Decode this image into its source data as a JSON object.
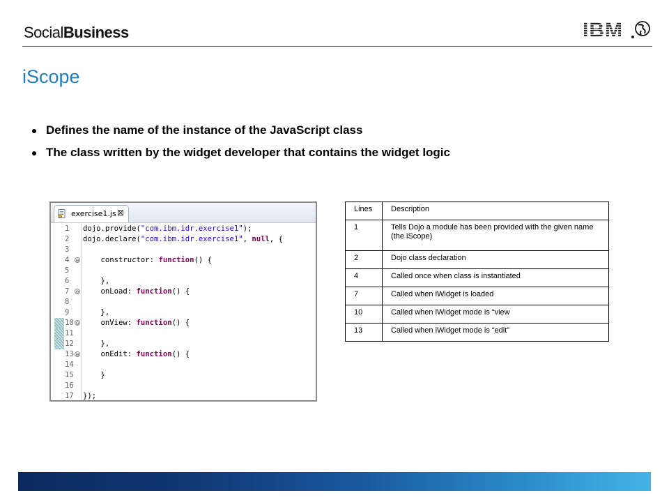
{
  "header": {
    "brand_part1": "Social",
    "brand_part2": "Business",
    "logo_text": "IBM"
  },
  "title": "iScope",
  "bullets": [
    "Defines the name of the instance of the JavaScript class",
    "The class written by the widget developer that contains the widget logic"
  ],
  "editor": {
    "tab_label": "exercise1.js",
    "tab_close": "⊠",
    "lines": [
      {
        "n": "1",
        "mark": false,
        "fold": ""
      },
      {
        "n": "2",
        "mark": false,
        "fold": ""
      },
      {
        "n": "3",
        "mark": false,
        "fold": ""
      },
      {
        "n": "4",
        "mark": false,
        "fold": "⊖"
      },
      {
        "n": "5",
        "mark": false,
        "fold": ""
      },
      {
        "n": "6",
        "mark": false,
        "fold": ""
      },
      {
        "n": "7",
        "mark": false,
        "fold": "⊖"
      },
      {
        "n": "8",
        "mark": false,
        "fold": ""
      },
      {
        "n": "9",
        "mark": false,
        "fold": ""
      },
      {
        "n": "10",
        "mark": true,
        "fold": "⊖"
      },
      {
        "n": "11",
        "mark": true,
        "fold": ""
      },
      {
        "n": "12",
        "mark": true,
        "fold": ""
      },
      {
        "n": "13",
        "mark": false,
        "fold": "⊖"
      },
      {
        "n": "14",
        "mark": false,
        "fold": ""
      },
      {
        "n": "15",
        "mark": false,
        "fold": ""
      },
      {
        "n": "16",
        "mark": false,
        "fold": ""
      },
      {
        "n": "17",
        "mark": false,
        "fold": ""
      }
    ],
    "code": {
      "l1_a": "dojo.provide(",
      "l1_s": "\"com.ibm.idr.exercise1\"",
      "l1_b": ");",
      "l2_a": "dojo.declare(",
      "l2_s": "\"com.ibm.idr.exercise1\"",
      "l2_b": ", ",
      "l2_k": "null",
      "l2_c": ", {",
      "l4_a": "    constructor: ",
      "l4_k": "function",
      "l4_b": "() {",
      "l6": "    },",
      "l7_a": "    onLoad: ",
      "l7_k": "function",
      "l7_b": "() {",
      "l9": "    },",
      "l10_a": "    onView: ",
      "l10_k": "function",
      "l10_b": "() {",
      "l12": "    },",
      "l13_a": "    onEdit: ",
      "l13_k": "function",
      "l13_b": "() {",
      "l15": "    }",
      "l17": "});"
    }
  },
  "table": {
    "headers": [
      "Lines",
      "Description"
    ],
    "rows": [
      {
        "line": "1",
        "desc": "Tells Dojo a module has been provided with the given name (the iScope)"
      },
      {
        "line": "2",
        "desc": "Dojo class declaration"
      },
      {
        "line": "4",
        "desc": "Called once when class is instantiated"
      },
      {
        "line": "7",
        "desc": "Called when iWidget is loaded"
      },
      {
        "line": "10",
        "desc": "Called when iWidget mode is “view"
      },
      {
        "line": "13",
        "desc": "Called when iWidget mode is “edit”"
      }
    ]
  },
  "colors": {
    "title": "#1f7ec1",
    "keyword": "#7f0055",
    "string": "#2a00ff"
  }
}
